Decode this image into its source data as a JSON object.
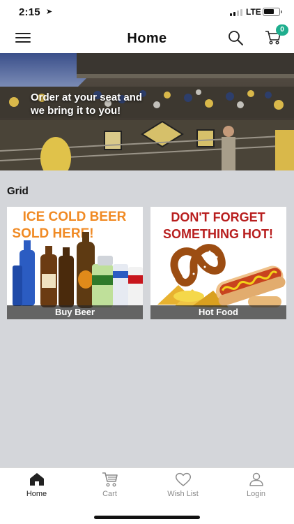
{
  "status_bar": {
    "time": "2:15",
    "location_glyph": "➤",
    "network": "LTE",
    "battery_level": 0.65
  },
  "navbar": {
    "title": "Home",
    "cart_count": "0",
    "accent_color": "#1fae8e"
  },
  "hero": {
    "text": "Order at your seat and we bring it to you!"
  },
  "grid": {
    "title": "Grid",
    "tiles": [
      {
        "label": "Buy Beer",
        "headline_line1": "ICE COLD BEER",
        "headline_line2": "SOLD HERE!"
      },
      {
        "label": "Hot Food",
        "headline_line1": "DON'T FORGET",
        "headline_line2": "SOMETHING HOT!"
      }
    ]
  },
  "tabbar": {
    "items": [
      {
        "label": "Home",
        "icon": "home-icon",
        "active": true
      },
      {
        "label": "Cart",
        "icon": "cart-icon",
        "active": false
      },
      {
        "label": "Wish List",
        "icon": "heart-icon",
        "active": false
      },
      {
        "label": "Login",
        "icon": "user-icon",
        "active": false
      }
    ]
  }
}
